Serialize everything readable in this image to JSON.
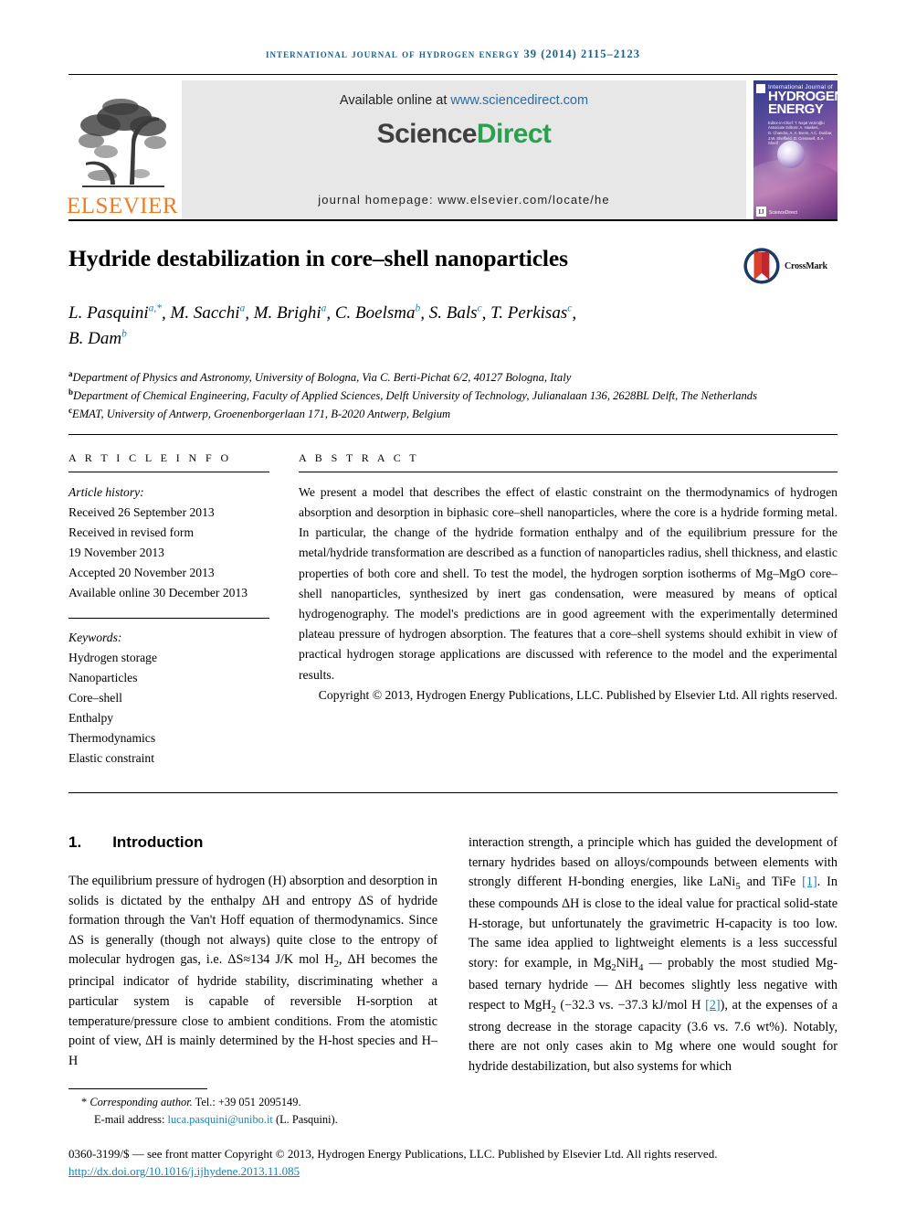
{
  "running_head": "INTERNATIONAL JOURNAL OF HYDROGEN ENERGY 39 (2014) 2115–2123",
  "masthead": {
    "elsevier_wordmark": "ELSEVIER",
    "available_online_prefix": "Available online at ",
    "sciencedirect_url": "www.sciencedirect.com",
    "sciencedirect_logo_part1": "Science",
    "sciencedirect_logo_part2": "Direct",
    "journal_homepage": "journal homepage: www.elsevier.com/locate/he",
    "cover": {
      "line_small": "International Journal of",
      "line_hydrogen": "HYDROGEN",
      "line_energy": "ENERGY",
      "editors": "Editor-in-Chief: T. Nejat Veziroğlu\nAssociate Editors: A. Hawkes, D. Chandra, A. A. Evers, A.C. Dunbar, J.W. Sheffield, D. Cresswell and S.A. Sherif",
      "sciencedirect_mark": "ScienceDirect"
    }
  },
  "article": {
    "title": "Hydride destabilization in core–shell nanoparticles",
    "crossmark_label": "CrossMark",
    "authors": [
      {
        "name": "L. Pasquini",
        "marks": "a,*"
      },
      {
        "name": "M. Sacchi",
        "marks": "a"
      },
      {
        "name": "M. Brighi",
        "marks": "a"
      },
      {
        "name": "C. Boelsma",
        "marks": "b"
      },
      {
        "name": "S. Bals",
        "marks": "c"
      },
      {
        "name": "T. Perkisas",
        "marks": "c"
      },
      {
        "name": "B. Dam",
        "marks": "b"
      }
    ],
    "affiliations": [
      {
        "mark": "a",
        "text": "Department of Physics and Astronomy, University of Bologna, Via C. Berti-Pichat 6/2, 40127 Bologna, Italy"
      },
      {
        "mark": "b",
        "text": "Department of Chemical Engineering, Faculty of Applied Sciences, Delft University of Technology, Julianalaan 136, 2628BL Delft, The Netherlands"
      },
      {
        "mark": "c",
        "text": "EMAT, University of Antwerp, Groenenborgerlaan 171, B-2020 Antwerp, Belgium"
      }
    ]
  },
  "article_info": {
    "heading": "A R T I C L E  I N F O",
    "history_label": "Article history:",
    "history": [
      "Received 26 September 2013",
      "Received in revised form",
      "19 November 2013",
      "Accepted 20 November 2013",
      "Available online 30 December 2013"
    ],
    "keywords_label": "Keywords:",
    "keywords": [
      "Hydrogen storage",
      "Nanoparticles",
      "Core–shell",
      "Enthalpy",
      "Thermodynamics",
      "Elastic constraint"
    ]
  },
  "abstract": {
    "heading": "A B S T R A C T",
    "body": "We present a model that describes the effect of elastic constraint on the thermodynamics of hydrogen absorption and desorption in biphasic core–shell nanoparticles, where the core is a hydride forming metal. In particular, the change of the hydride formation enthalpy and of the equilibrium pressure for the metal/hydride transformation are described as a function of nanoparticles radius, shell thickness, and elastic properties of both core and shell. To test the model, the hydrogen sorption isotherms of Mg–MgO core–shell nanoparticles, synthesized by inert gas condensation, were measured by means of optical hydrogenography. The model's predictions are in good agreement with the experimentally determined plateau pressure of hydrogen absorption. The features that a core–shell systems should exhibit in view of practical hydrogen storage applications are discussed with reference to the model and the experimental results.",
    "copyright": "Copyright © 2013, Hydrogen Energy Publications, LLC. Published by Elsevier Ltd. All rights reserved."
  },
  "introduction": {
    "number": "1.",
    "title": "Introduction",
    "left_paragraph_part1": "The equilibrium pressure of hydrogen (H) absorption and desorption in solids is dictated by the enthalpy ΔH and entropy ΔS of hydride formation through the Van't Hoff equation of thermodynamics. Since ΔS is generally (though not always) quite close to the entropy of molecular hydrogen gas, i.e. ΔS≈134 J/K mol H",
    "left_paragraph_part2": ", ΔH becomes the principal indicator of hydride stability, discriminating whether a particular system is capable of reversible H-sorption at temperature/pressure close to ambient conditions. From the atomistic point of view, ΔH is mainly determined by the H-host species and H–H",
    "right_part1": "interaction strength, a principle which has guided the development of ternary hydrides based on alloys/compounds between elements with strongly different H-bonding energies, like LaNi",
    "right_part2": " and TiFe ",
    "ref1": "[1]",
    "right_part3": ". In these compounds ΔH is close to the ideal value for practical solid-state H-storage, but unfortunately the gravimetric H-capacity is too low. The same idea applied to lightweight elements is a less successful story: for example, in Mg",
    "right_part4": "NiH",
    "right_part5": " — probably the most studied Mg-based ternary hydride — ΔH becomes slightly less negative with respect to MgH",
    "right_part6": " (−32.3 vs. −37.3 kJ/mol H ",
    "ref2": "[2]",
    "right_part7": "), at the expenses of a strong decrease in the storage capacity (3.6 vs. 7.6 wt%). Notably, there are not only cases akin to Mg where one would sought for hydride destabilization, but also systems for which"
  },
  "footer": {
    "corresponding_label": "Corresponding author.",
    "tel": " Tel.: +39 051 2095149.",
    "email_label": "E-mail address: ",
    "email": "luca.pasquini@unibo.it",
    "email_suffix": " (L. Pasquini).",
    "front_matter": "0360-3199/$ — see front matter Copyright © 2013, Hydrogen Energy Publications, LLC. Published by Elsevier Ltd. All rights reserved.",
    "doi": "http://dx.doi.org/10.1016/j.ijhydene.2013.11.085"
  },
  "colors": {
    "link": "#1b82b5",
    "running_head": "#1b5e8c",
    "elsevier_orange": "#ef7c22",
    "sciencedirect_green": "#2aa14f"
  }
}
